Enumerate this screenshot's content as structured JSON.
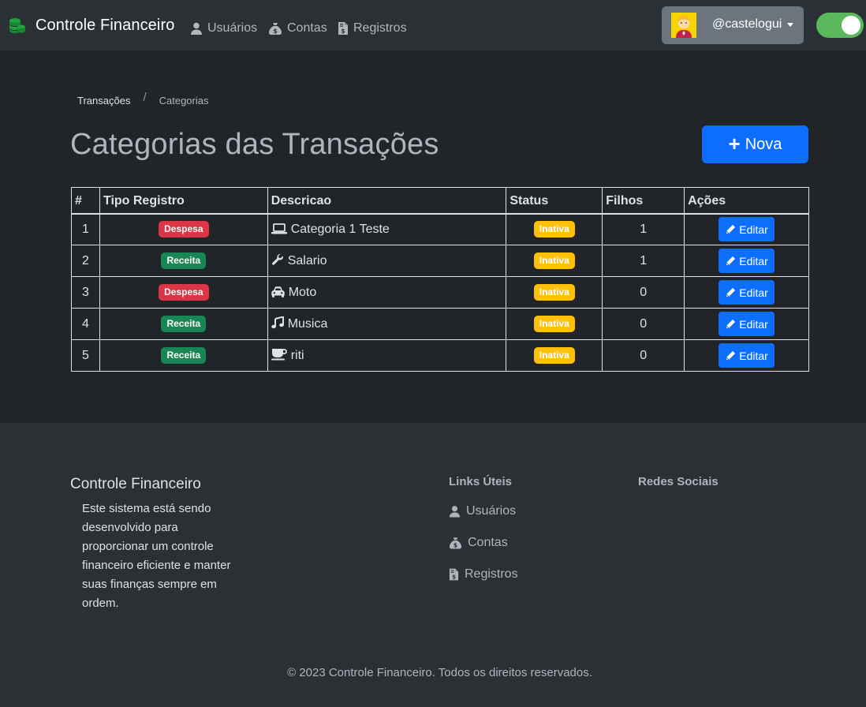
{
  "navbar": {
    "brand": "Controle Financeiro",
    "links": [
      {
        "label": "Usuários",
        "icon": "user-icon"
      },
      {
        "label": "Contas",
        "icon": "money-bag-icon"
      },
      {
        "label": "Registros",
        "icon": "file-invoice-dollar-icon"
      }
    ],
    "user": "@castelogui",
    "theme_toggle": {
      "on": true
    }
  },
  "breadcrumb": {
    "items": [
      "Transações",
      "Categorias"
    ],
    "separator": "/"
  },
  "page_title": "Categorias das Transações",
  "new_button": "Nova",
  "table": {
    "headers": [
      "#",
      "Tipo Registro",
      "Descricao",
      "Status",
      "Filhos",
      "Ações"
    ],
    "rows": [
      {
        "id": "1",
        "tipo": "Despesa",
        "icon": "laptop-icon",
        "descricao": "Categoria 1 Teste",
        "status": "Inativa",
        "filhos": "1",
        "acao": "Editar"
      },
      {
        "id": "2",
        "tipo": "Receita",
        "icon": "wrench-icon",
        "descricao": "Salario",
        "status": "Inativa",
        "filhos": "1",
        "acao": "Editar"
      },
      {
        "id": "3",
        "tipo": "Despesa",
        "icon": "car-icon",
        "descricao": "Moto",
        "status": "Inativa",
        "filhos": "0",
        "acao": "Editar"
      },
      {
        "id": "4",
        "tipo": "Receita",
        "icon": "music-icon",
        "descricao": "Musica",
        "status": "Inativa",
        "filhos": "0",
        "acao": "Editar"
      },
      {
        "id": "5",
        "tipo": "Receita",
        "icon": "coffee-icon",
        "descricao": "riti",
        "status": "Inativa",
        "filhos": "0",
        "acao": "Editar"
      }
    ]
  },
  "footer": {
    "title": "Controle Financeiro",
    "description": "Este sistema está sendo desenvolvido para proporcionar um controle financeiro eficiente e manter suas finanças sempre em ordem.",
    "links_heading": "Links Úteis",
    "links": [
      {
        "label": "Usuários",
        "icon": "user-icon"
      },
      {
        "label": "Contas",
        "icon": "money-bag-icon"
      },
      {
        "label": "Registros",
        "icon": "file-invoice-dollar-icon"
      }
    ],
    "social_heading": "Redes Sociais",
    "copyright": "© 2023 Controle Financeiro. Todos os direitos reservados."
  },
  "colors": {
    "despesa": "#dc3545",
    "receita": "#198754",
    "inativa": "#ffc107",
    "primary": "#0d6efd",
    "toggle": "#5cb85c"
  }
}
